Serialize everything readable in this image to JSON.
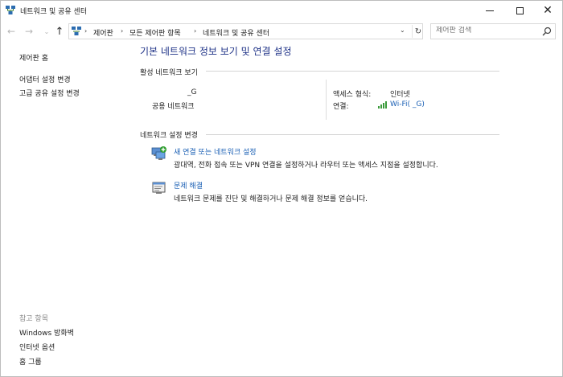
{
  "window": {
    "title": "네트워크 및 공유 센터",
    "icon": "network-center-icon"
  },
  "address_bar": {
    "crumbs": [
      "제어판",
      "모든 제어판 항목",
      "네트워크 및 공유 센터"
    ]
  },
  "search": {
    "placeholder": "제어판 검색"
  },
  "left_pane": {
    "home": "제어판 홈",
    "links": [
      "어댑터 설정 변경",
      "고급 공유 설정 변경"
    ],
    "see_also_header": "참고 항목",
    "see_also": [
      "Windows 방화벽",
      "인터넷 옵션",
      "홈 그룹"
    ]
  },
  "main": {
    "title": "기본 네트워크 정보 보기 및 연결 설정",
    "active_networks": {
      "header": "활성 네트워크 보기",
      "network_name": "_G",
      "network_type": "공용 네트워크",
      "access_type_label": "액세스 형식:",
      "access_type_value": "인터넷",
      "connection_label": "연결:",
      "connection_value": "Wi-Fi(              _G)"
    },
    "change_settings": {
      "header": "네트워크 설정 변경",
      "tasks": [
        {
          "link": "새 연결 또는 네트워크 설정",
          "description": "광대역, 전화 접속 또는 VPN 연결을 설정하거나 라우터 또는 액세스 지점을 설정합니다.",
          "icon": "new-connection-icon"
        },
        {
          "link": "문제 해결",
          "description": "네트워크 문제를 진단 및 해결하거나 문제 해결 정보를 얻습니다.",
          "icon": "troubleshoot-icon"
        }
      ]
    }
  },
  "colors": {
    "title_blue": "#1e3287",
    "link_blue": "#1a5fb4",
    "muted": "#8a8a8a",
    "divider": "#d5d5d5"
  }
}
